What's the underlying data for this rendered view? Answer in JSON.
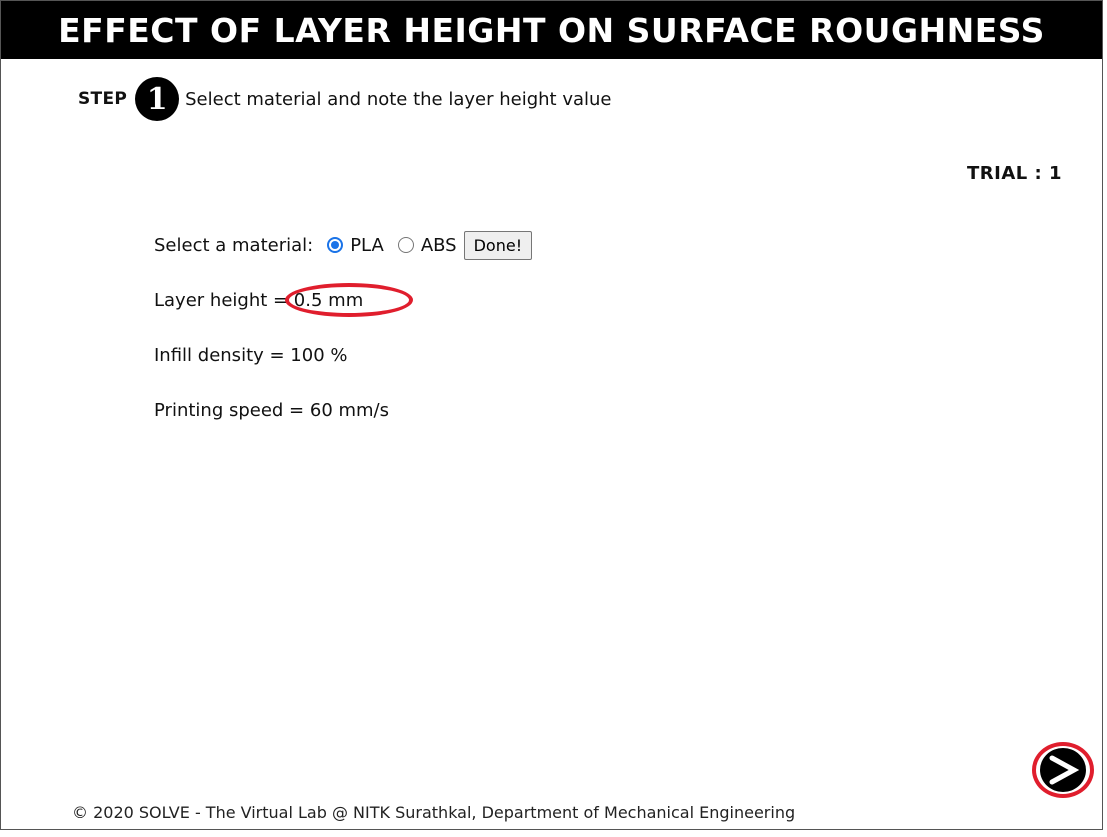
{
  "header": {
    "title": "EFFECT OF LAYER HEIGHT ON SURFACE ROUGHNESS"
  },
  "step": {
    "label": "STEP",
    "number": "1",
    "instruction": "Select material and note the layer height value"
  },
  "trial": {
    "text": "TRIAL : 1"
  },
  "material": {
    "label": "Select a material:",
    "options": [
      {
        "label": "PLA",
        "checked": true
      },
      {
        "label": "ABS",
        "checked": false
      }
    ],
    "done_label": "Done!"
  },
  "parameters": {
    "layer_height": "Layer height = 0.5 mm",
    "infill_density": "Infill density = 100 %",
    "printing_speed": "Printing speed = 60 mm/s"
  },
  "footer": {
    "text": "© 2020 SOLVE - The Virtual Lab @ NITK Surathkal, Department of Mechanical Engineering"
  },
  "colors": {
    "highlight": "#e01e2d",
    "radio_accent": "#1a73e8",
    "title_bg": "#000000"
  }
}
